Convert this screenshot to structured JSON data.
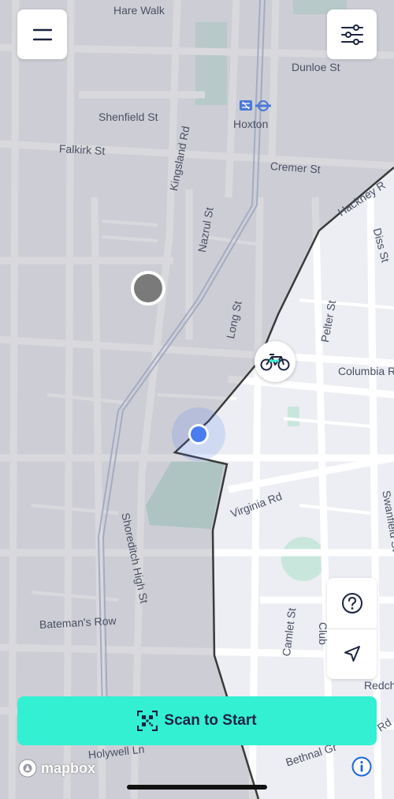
{
  "colors": {
    "accent": "#33f0d2",
    "user_dot": "#4b7cf0",
    "zone_border": "#3a3a3a",
    "outside_shade": "#9a9aa6",
    "park": "#c9e6dd"
  },
  "menu_button": {
    "icon": "hamburger-icon"
  },
  "filter_button": {
    "icon": "sliders-icon"
  },
  "streets": {
    "hare_walk": "Hare Walk",
    "dunloe_st": "Dunloe St",
    "shenfield_st": "Shenfield St",
    "hoxton": "Hoxton",
    "falkirk_st": "Falkirk St",
    "kingsland_rd": "Kingsland Rd",
    "cremer_st": "Cremer St",
    "hackney_rd": "Hackney R",
    "diss_st": "Diss St",
    "nazrul_st": "Nazrul St",
    "pelter_st": "Pelter St",
    "long_st": "Long St",
    "columbia_rd": "Columbia R",
    "virginia_rd": "Virginia Rd",
    "swanfield_st": "Swanfield St",
    "shoreditch_high_st": "Shoreditch High St",
    "bateman_row": "Bateman's Row",
    "camlet_st": "Camlet St",
    "club_row": "Club",
    "redchurch": "Redch",
    "holywell_ln": "Holywell Ln",
    "bethnal_green": "Bethnal Gr",
    "rd_fragment": "Rd"
  },
  "bike_marker": {
    "icon": "bicycle-icon"
  },
  "help_button": {
    "icon": "question-icon"
  },
  "locate_button": {
    "icon": "navigation-arrow-icon"
  },
  "scan_button": {
    "label": "Scan to Start",
    "icon": "qr-scan-icon"
  },
  "attribution": {
    "brand": "mapbox",
    "info_icon": "info-icon"
  }
}
